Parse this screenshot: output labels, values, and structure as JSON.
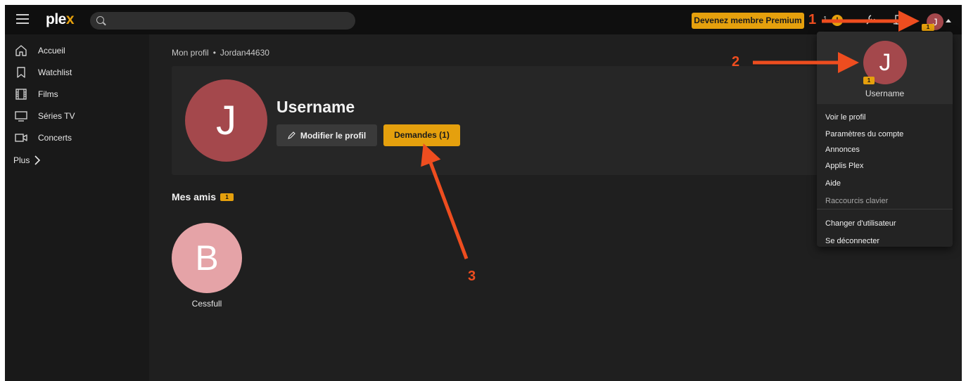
{
  "topbar": {
    "logo_main": "ple",
    "logo_accent": "x",
    "search_placeholder": "",
    "premium_label": "Devenez membre Premium",
    "alerts_count": "1",
    "alert_symbol": "!",
    "avatar_initial": "J",
    "avatar_badge": "1"
  },
  "sidebar": {
    "items": [
      {
        "label": "Accueil",
        "icon": "home-icon"
      },
      {
        "label": "Watchlist",
        "icon": "bookmark-icon"
      },
      {
        "label": "Films",
        "icon": "film-icon"
      },
      {
        "label": "Séries TV",
        "icon": "tv-icon"
      },
      {
        "label": "Concerts",
        "icon": "camera-icon"
      }
    ],
    "more_label": "Plus"
  },
  "breadcrumb": {
    "section": "Mon profil",
    "separator": "•",
    "user": "Jordan44630"
  },
  "profile": {
    "initial": "J",
    "username": "Username",
    "edit_label": "Modifier le profil",
    "requests_label": "Demandes (1)"
  },
  "friends": {
    "title": "Mes amis",
    "count": "1",
    "list": [
      {
        "initial": "B",
        "name": "Cessfull"
      }
    ]
  },
  "dropdown": {
    "initial": "J",
    "badge": "1",
    "username": "Username",
    "items": [
      "Voir le profil",
      "Paramètres du compte",
      "Annonces",
      "Applis Plex",
      "Aide",
      "Raccourcis clavier"
    ],
    "items_bottom": [
      "Changer d'utilisateur",
      "Se déconnecter"
    ]
  },
  "annotations": {
    "labels": [
      "1",
      "2",
      "3"
    ]
  },
  "colors": {
    "accent": "#e5a00d",
    "avatar": "#a4484c",
    "friend_avatar": "#e5a3a7",
    "annotation": "#ee4d1f"
  }
}
